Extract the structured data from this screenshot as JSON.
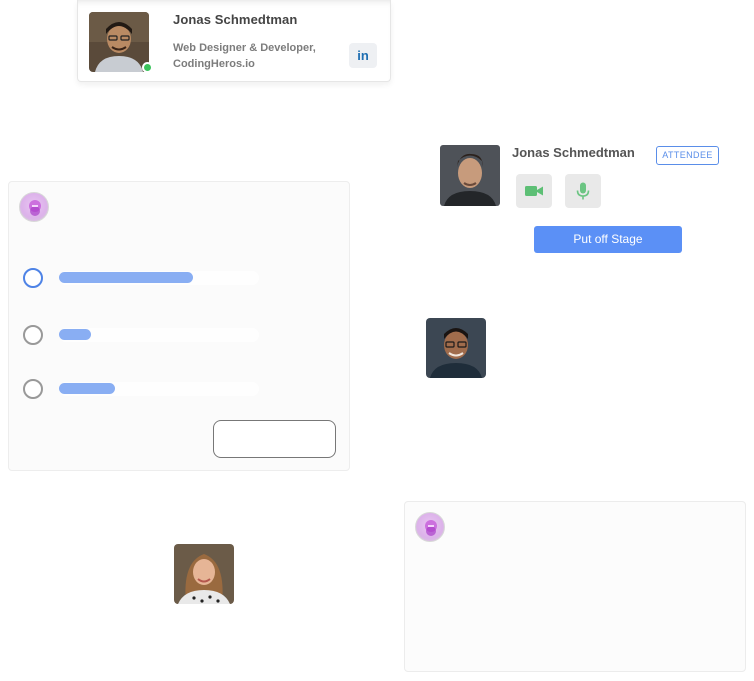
{
  "profile_card": {
    "name": "Jonas Schmedtman",
    "role_line1": "Web Designer & Developer,",
    "role_line2": "CodingHeros.io",
    "linkedin_label": "in",
    "status_color": "#3bc35c"
  },
  "stage": {
    "name": "Jonas Schmedtman",
    "badge": "ATTENDEE",
    "camera_icon": "video-camera-icon",
    "mic_icon": "microphone-icon",
    "action_label": "Put off Stage",
    "accent": "#5b90f6"
  },
  "poll": {
    "logo_icon": "app-logo-icon",
    "options": [
      {
        "selected": true,
        "bar_fraction": 0.67
      },
      {
        "selected": false,
        "bar_fraction": 0.16
      },
      {
        "selected": false,
        "bar_fraction": 0.28
      }
    ]
  },
  "avatars": [
    "speaker-avatar",
    "attendee-avatar"
  ],
  "empty_card": {
    "logo_icon": "app-logo-icon"
  }
}
